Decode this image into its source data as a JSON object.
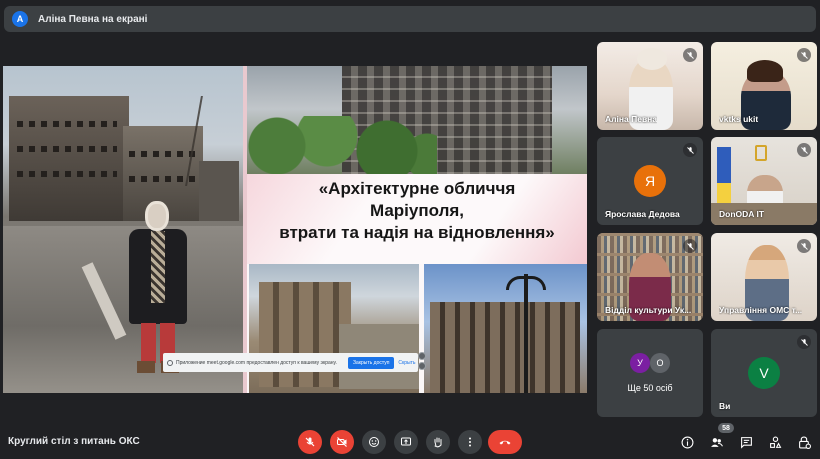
{
  "banner": {
    "avatar_letter": "A",
    "presenter_text": "Аліна Певна на екрані"
  },
  "slide": {
    "title_line1": "«Архітектурне обличчя",
    "title_line2": "Маріуполя,",
    "title_line3": "втрати та надія на відновлення»"
  },
  "share_notice": {
    "text": "Приложение meet.google.com предоставлен доступ к вашему экрану.",
    "stop_button": "Закрыть доступ",
    "hide_button": "Скрыть"
  },
  "participants": [
    {
      "name": "Аліна Певна"
    },
    {
      "name": "vktks ukit"
    },
    {
      "name": "Ярослава Дедова",
      "avatar_letter": "Я",
      "avatar_color": "#e8710a"
    },
    {
      "name": "DonODA IT"
    },
    {
      "name": "Відділ культури Ук..."
    },
    {
      "name": "Управління ОМС т..."
    },
    {
      "name": "Ви",
      "avatar_letter": "V",
      "avatar_color": "#0b8043"
    }
  ],
  "more": {
    "label": "Ще 50 осіб",
    "avatars": [
      {
        "letter": "У",
        "color": "#7b1fa2"
      },
      {
        "letter": "О",
        "color": "#5f6368"
      }
    ]
  },
  "meeting": {
    "title": "Круглий стіл з питань ОКС",
    "participant_count": "58"
  },
  "colors": {
    "background": "#202124",
    "tile": "#3c4043",
    "danger": "#ea4335",
    "accent": "#1a73e8"
  }
}
